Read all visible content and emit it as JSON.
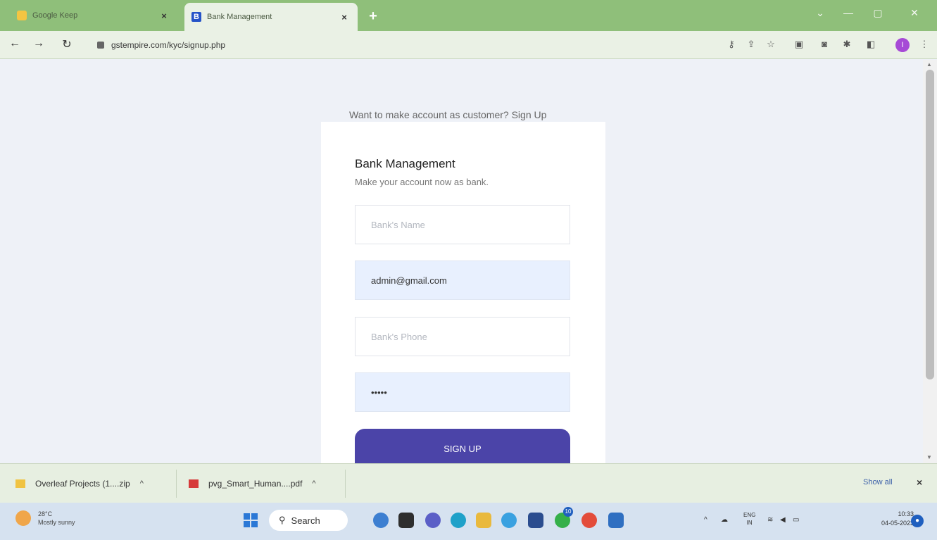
{
  "browser": {
    "tabs": [
      {
        "title": "Google Keep",
        "active": false
      },
      {
        "title": "Bank Management",
        "active": true
      }
    ],
    "new_tab_label": "+",
    "close_glyph": "×",
    "url": "gstempire.com/kyc/signup.php",
    "profile_initial": "I",
    "accent": "#8fbf7a"
  },
  "page": {
    "signup_prompt": "Want to make account as customer? Sign Up",
    "card": {
      "title": "Bank Management",
      "subtitle": "Make your account now as bank.",
      "fields": {
        "bank_name": {
          "placeholder": "Bank's Name",
          "value": ""
        },
        "email": {
          "placeholder": "",
          "value": "admin@gmail.com"
        },
        "bank_phone": {
          "placeholder": "Bank's Phone",
          "value": ""
        },
        "password": {
          "placeholder": "",
          "value": "•••••"
        }
      },
      "submit_label": "SIGN UP",
      "button_color": "#4b44a8"
    }
  },
  "downloads": {
    "items": [
      {
        "name": "Overleaf Projects (1....zip"
      },
      {
        "name": "pvg_Smart_Human....pdf"
      }
    ],
    "show_all_label": "Show all",
    "close_glyph": "×"
  },
  "taskbar": {
    "weather": {
      "temp": "28°C",
      "condition": "Mostly sunny"
    },
    "search_label": "Search",
    "language": {
      "line1": "ENG",
      "line2": "IN"
    },
    "time": "10:33",
    "date": "04-05-2023",
    "badge": "10"
  }
}
